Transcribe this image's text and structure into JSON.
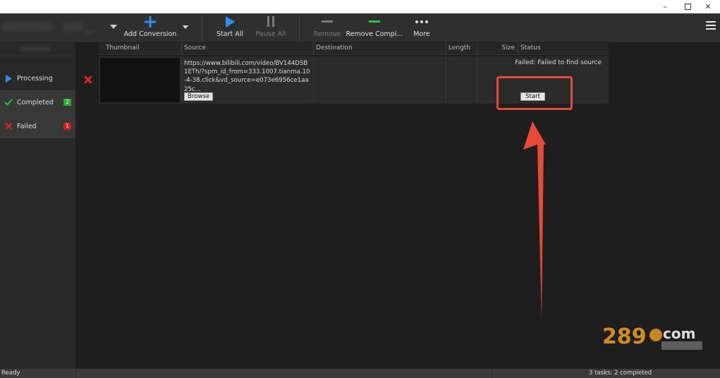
{
  "toolbar": {
    "add_conversion": "Add Conversion",
    "start_all": "Start All",
    "pause_all": "Pause All",
    "remove": "Remove",
    "remove_completed": "Remove Compl...",
    "more": "More"
  },
  "sidebar": {
    "items": [
      {
        "label": "Processing",
        "icon": "play-icon"
      },
      {
        "label": "Completed",
        "icon": "check-icon",
        "badge": "2",
        "badge_color": "#2eaa2e"
      },
      {
        "label": "Failed",
        "icon": "x-icon",
        "badge": "1",
        "badge_color": "#d42020"
      }
    ]
  },
  "table": {
    "columns": [
      "Thumbnail",
      "Source",
      "Destination",
      "Length",
      "Size",
      "Status"
    ],
    "rows": [
      {
        "source": "https://www.bilibili.com/video/BV144DSB1ETh/?spm_id_from=333.1007.tianma.10-4-38.click&vd_source=e073e6956ce1aa25c...",
        "browse_label": "Browse",
        "status": "Failed: Failed to find source",
        "start_label": "Start"
      }
    ]
  },
  "statusbar": {
    "left": "Ready",
    "right": "3 tasks: 2 completed"
  },
  "colors": {
    "accent_blue": "#2f8cf0",
    "accent_green": "#27c43a",
    "fail_red": "#e52424",
    "annotation_red": "#e84a38"
  }
}
